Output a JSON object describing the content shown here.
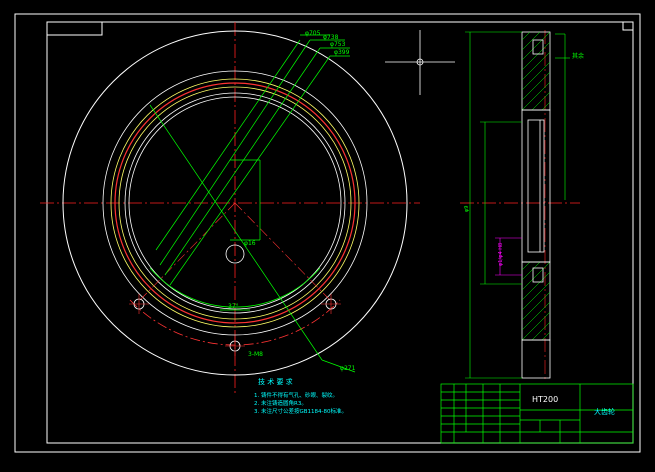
{
  "drawing": {
    "colors": {
      "background": "#000000",
      "frame": "#ffffff",
      "centerline": "#ff2020",
      "dimension": "#00ff00",
      "outline": "#ffffff",
      "inner_ring_yellow": "#ffff66",
      "inner_ring_red": "#ff3333",
      "hatch": "#00ff00",
      "magenta": "#ff00ff",
      "cyan": "#00ffff"
    },
    "dimensions": {
      "d1": "φ705",
      "d2": "φ738",
      "d3": "φ753",
      "d4": "φ399",
      "d_small": "φ16",
      "angle": "37°",
      "holes": "3-M8",
      "d_out": "φ271"
    },
    "side_view": {
      "finish_symbol": "其余",
      "label_vertical_1": "φ9",
      "label_vertical_2": "φ1/φ4 H8"
    },
    "tech_requirements": {
      "title": "技 术 要 求",
      "items": [
        "1. 铸件不得有气孔、砂眼、裂纹。",
        "2. 未注铸造圆角R3。",
        "3. 未注尺寸公差按GB1184-80标准。"
      ]
    },
    "title_block": {
      "material": "HT200",
      "part_name": "大齿轮"
    }
  }
}
